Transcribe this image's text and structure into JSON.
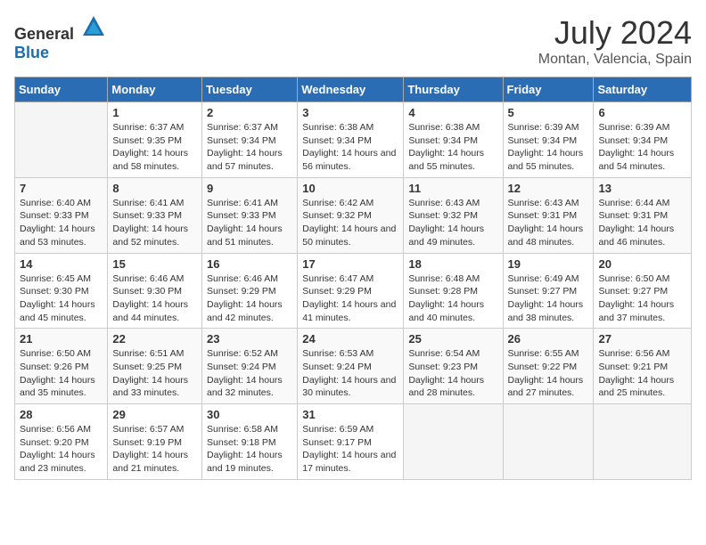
{
  "header": {
    "logo_general": "General",
    "logo_blue": "Blue",
    "title": "July 2024",
    "subtitle": "Montan, Valencia, Spain"
  },
  "calendar": {
    "days_of_week": [
      "Sunday",
      "Monday",
      "Tuesday",
      "Wednesday",
      "Thursday",
      "Friday",
      "Saturday"
    ],
    "weeks": [
      [
        {
          "day": "",
          "sunrise": "",
          "sunset": "",
          "daylight": ""
        },
        {
          "day": "1",
          "sunrise": "Sunrise: 6:37 AM",
          "sunset": "Sunset: 9:35 PM",
          "daylight": "Daylight: 14 hours and 58 minutes."
        },
        {
          "day": "2",
          "sunrise": "Sunrise: 6:37 AM",
          "sunset": "Sunset: 9:34 PM",
          "daylight": "Daylight: 14 hours and 57 minutes."
        },
        {
          "day": "3",
          "sunrise": "Sunrise: 6:38 AM",
          "sunset": "Sunset: 9:34 PM",
          "daylight": "Daylight: 14 hours and 56 minutes."
        },
        {
          "day": "4",
          "sunrise": "Sunrise: 6:38 AM",
          "sunset": "Sunset: 9:34 PM",
          "daylight": "Daylight: 14 hours and 55 minutes."
        },
        {
          "day": "5",
          "sunrise": "Sunrise: 6:39 AM",
          "sunset": "Sunset: 9:34 PM",
          "daylight": "Daylight: 14 hours and 55 minutes."
        },
        {
          "day": "6",
          "sunrise": "Sunrise: 6:39 AM",
          "sunset": "Sunset: 9:34 PM",
          "daylight": "Daylight: 14 hours and 54 minutes."
        }
      ],
      [
        {
          "day": "7",
          "sunrise": "Sunrise: 6:40 AM",
          "sunset": "Sunset: 9:33 PM",
          "daylight": "Daylight: 14 hours and 53 minutes."
        },
        {
          "day": "8",
          "sunrise": "Sunrise: 6:41 AM",
          "sunset": "Sunset: 9:33 PM",
          "daylight": "Daylight: 14 hours and 52 minutes."
        },
        {
          "day": "9",
          "sunrise": "Sunrise: 6:41 AM",
          "sunset": "Sunset: 9:33 PM",
          "daylight": "Daylight: 14 hours and 51 minutes."
        },
        {
          "day": "10",
          "sunrise": "Sunrise: 6:42 AM",
          "sunset": "Sunset: 9:32 PM",
          "daylight": "Daylight: 14 hours and 50 minutes."
        },
        {
          "day": "11",
          "sunrise": "Sunrise: 6:43 AM",
          "sunset": "Sunset: 9:32 PM",
          "daylight": "Daylight: 14 hours and 49 minutes."
        },
        {
          "day": "12",
          "sunrise": "Sunrise: 6:43 AM",
          "sunset": "Sunset: 9:31 PM",
          "daylight": "Daylight: 14 hours and 48 minutes."
        },
        {
          "day": "13",
          "sunrise": "Sunrise: 6:44 AM",
          "sunset": "Sunset: 9:31 PM",
          "daylight": "Daylight: 14 hours and 46 minutes."
        }
      ],
      [
        {
          "day": "14",
          "sunrise": "Sunrise: 6:45 AM",
          "sunset": "Sunset: 9:30 PM",
          "daylight": "Daylight: 14 hours and 45 minutes."
        },
        {
          "day": "15",
          "sunrise": "Sunrise: 6:46 AM",
          "sunset": "Sunset: 9:30 PM",
          "daylight": "Daylight: 14 hours and 44 minutes."
        },
        {
          "day": "16",
          "sunrise": "Sunrise: 6:46 AM",
          "sunset": "Sunset: 9:29 PM",
          "daylight": "Daylight: 14 hours and 42 minutes."
        },
        {
          "day": "17",
          "sunrise": "Sunrise: 6:47 AM",
          "sunset": "Sunset: 9:29 PM",
          "daylight": "Daylight: 14 hours and 41 minutes."
        },
        {
          "day": "18",
          "sunrise": "Sunrise: 6:48 AM",
          "sunset": "Sunset: 9:28 PM",
          "daylight": "Daylight: 14 hours and 40 minutes."
        },
        {
          "day": "19",
          "sunrise": "Sunrise: 6:49 AM",
          "sunset": "Sunset: 9:27 PM",
          "daylight": "Daylight: 14 hours and 38 minutes."
        },
        {
          "day": "20",
          "sunrise": "Sunrise: 6:50 AM",
          "sunset": "Sunset: 9:27 PM",
          "daylight": "Daylight: 14 hours and 37 minutes."
        }
      ],
      [
        {
          "day": "21",
          "sunrise": "Sunrise: 6:50 AM",
          "sunset": "Sunset: 9:26 PM",
          "daylight": "Daylight: 14 hours and 35 minutes."
        },
        {
          "day": "22",
          "sunrise": "Sunrise: 6:51 AM",
          "sunset": "Sunset: 9:25 PM",
          "daylight": "Daylight: 14 hours and 33 minutes."
        },
        {
          "day": "23",
          "sunrise": "Sunrise: 6:52 AM",
          "sunset": "Sunset: 9:24 PM",
          "daylight": "Daylight: 14 hours and 32 minutes."
        },
        {
          "day": "24",
          "sunrise": "Sunrise: 6:53 AM",
          "sunset": "Sunset: 9:24 PM",
          "daylight": "Daylight: 14 hours and 30 minutes."
        },
        {
          "day": "25",
          "sunrise": "Sunrise: 6:54 AM",
          "sunset": "Sunset: 9:23 PM",
          "daylight": "Daylight: 14 hours and 28 minutes."
        },
        {
          "day": "26",
          "sunrise": "Sunrise: 6:55 AM",
          "sunset": "Sunset: 9:22 PM",
          "daylight": "Daylight: 14 hours and 27 minutes."
        },
        {
          "day": "27",
          "sunrise": "Sunrise: 6:56 AM",
          "sunset": "Sunset: 9:21 PM",
          "daylight": "Daylight: 14 hours and 25 minutes."
        }
      ],
      [
        {
          "day": "28",
          "sunrise": "Sunrise: 6:56 AM",
          "sunset": "Sunset: 9:20 PM",
          "daylight": "Daylight: 14 hours and 23 minutes."
        },
        {
          "day": "29",
          "sunrise": "Sunrise: 6:57 AM",
          "sunset": "Sunset: 9:19 PM",
          "daylight": "Daylight: 14 hours and 21 minutes."
        },
        {
          "day": "30",
          "sunrise": "Sunrise: 6:58 AM",
          "sunset": "Sunset: 9:18 PM",
          "daylight": "Daylight: 14 hours and 19 minutes."
        },
        {
          "day": "31",
          "sunrise": "Sunrise: 6:59 AM",
          "sunset": "Sunset: 9:17 PM",
          "daylight": "Daylight: 14 hours and 17 minutes."
        },
        {
          "day": "",
          "sunrise": "",
          "sunset": "",
          "daylight": ""
        },
        {
          "day": "",
          "sunrise": "",
          "sunset": "",
          "daylight": ""
        },
        {
          "day": "",
          "sunrise": "",
          "sunset": "",
          "daylight": ""
        }
      ]
    ]
  }
}
